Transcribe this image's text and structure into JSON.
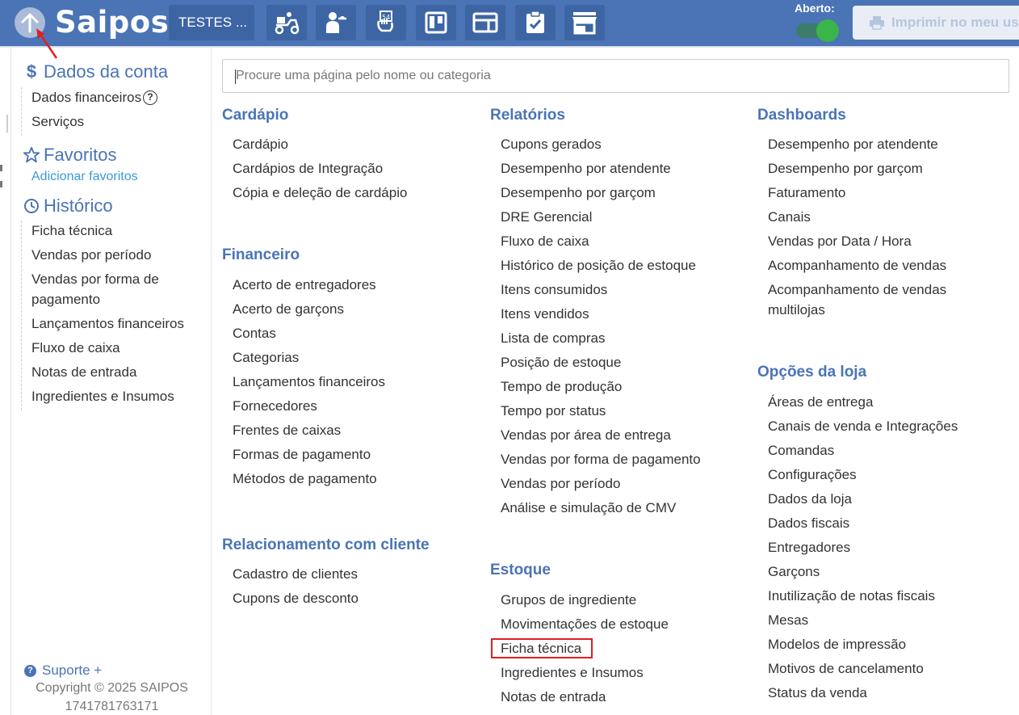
{
  "topbar": {
    "logo": "Saipos",
    "store_name": "TESTES ...",
    "tools": [
      "delivery-icon",
      "waiter-icon",
      "table-number-icon",
      "kanban-icon",
      "panel-icon",
      "checklist-icon",
      "store-icon"
    ],
    "aberto_label": "Aberto:",
    "print_label": "Imprimir no meu usu"
  },
  "sidebar": {
    "account_title": "Dados da conta",
    "account_items": [
      "Dados financeiros",
      "Serviços"
    ],
    "favorites_title": "Favoritos",
    "favorites_link": "Adicionar favoritos",
    "history_title": "Histórico",
    "history_items": [
      "Ficha técnica",
      "Vendas por período",
      "Vendas por forma de pagamento",
      "Lançamentos financeiros",
      "Fluxo de caixa",
      "Notas de entrada",
      "Ingredientes e Insumos"
    ],
    "support_label": "Suporte +",
    "copyright": "Copyright © 2025 SAIPOS",
    "build": "1741781763171"
  },
  "search": {
    "placeholder": "Procure uma página pelo nome ou categoria"
  },
  "categories": {
    "cardapio": {
      "title": "Cardápio",
      "items": [
        "Cardápio",
        "Cardápios de Integração",
        "Cópia e deleção de cardápio"
      ]
    },
    "financeiro": {
      "title": "Financeiro",
      "items": [
        "Acerto de entregadores",
        "Acerto de garçons",
        "Contas",
        "Categorias",
        "Lançamentos financeiros",
        "Fornecedores",
        "Frentes de caixas",
        "Formas de pagamento",
        "Métodos de pagamento"
      ]
    },
    "relacionamento": {
      "title": "Relacionamento com cliente",
      "items": [
        "Cadastro de clientes",
        "Cupons de desconto"
      ]
    },
    "relatorios": {
      "title": "Relatórios",
      "items": [
        "Cupons gerados",
        "Desempenho por atendente",
        "Desempenho por garçom",
        "DRE Gerencial",
        "Fluxo de caixa",
        "Histórico de posição de estoque",
        "Itens consumidos",
        "Itens vendidos",
        "Lista de compras",
        "Posição de estoque",
        "Tempo de produção",
        "Tempo por status",
        "Vendas por área de entrega",
        "Vendas por forma de pagamento",
        "Vendas por período",
        "Análise e simulação de CMV"
      ]
    },
    "estoque": {
      "title": "Estoque",
      "items": [
        "Grupos de ingrediente",
        "Movimentações de estoque",
        "Ficha técnica",
        "Ingredientes e Insumos",
        "Notas de entrada"
      ]
    },
    "dashboards": {
      "title": "Dashboards",
      "items": [
        "Desempenho por atendente",
        "Desempenho por garçom",
        "Faturamento",
        "Canais",
        "Vendas por Data / Hora",
        "Acompanhamento de vendas",
        "Acompanhamento de vendas multilojas"
      ]
    },
    "opcoes": {
      "title": "Opções da loja",
      "items": [
        "Áreas de entrega",
        "Canais de venda e Integrações",
        "Comandas",
        "Configurações",
        "Dados da loja",
        "Dados fiscais",
        "Entregadores",
        "Garçons",
        "Inutilização de notas fiscais",
        "Mesas",
        "Modelos de impressão",
        "Motivos de cancelamento",
        "Status da venda"
      ]
    }
  },
  "colors": {
    "topbar": "#4a74b5",
    "accent": "#4a74b5",
    "highlight": "#e02020",
    "toggle_on": "#39b54a",
    "link": "#3a9ad9"
  }
}
